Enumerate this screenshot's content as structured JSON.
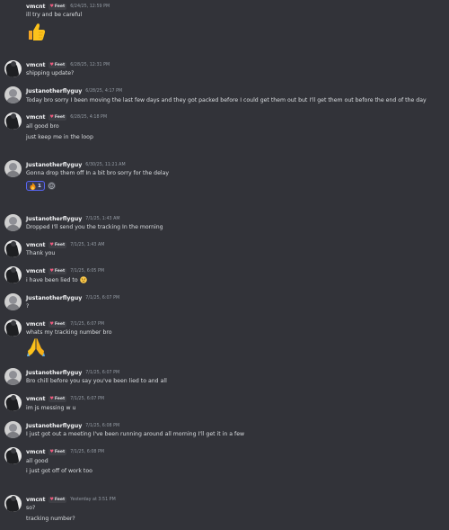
{
  "tag": {
    "name": "Feet"
  },
  "messages": [
    {
      "username": "vmcnt",
      "tag": true,
      "timestamp": "6/24/25, 12:59 PM",
      "lines": [
        "ill try and be careful"
      ]
    },
    {
      "username": "vmcnt",
      "tag": true,
      "timestamp": "6/28/25, 12:31 PM",
      "lines": [
        "shipping update?"
      ]
    },
    {
      "username": "Justanotherflyguy",
      "tag": false,
      "timestamp": "6/28/25, 4:17 PM",
      "lines": [
        "Today bro sorry I been moving the last few days and they got packed before I could get them out but I'll get them out before the end of the day"
      ]
    },
    {
      "username": "vmcnt",
      "tag": true,
      "timestamp": "6/28/25, 4:18 PM",
      "lines": [
        "all good bro",
        "just keep me in the loop"
      ]
    },
    {
      "username": "Justanotherflyguy",
      "tag": false,
      "timestamp": "6/30/25, 11:21 AM",
      "lines": [
        "Gonna drop  them off In a bit bro sorry for the delay"
      ],
      "reaction_count": "1"
    },
    {
      "username": "Justanotherflyguy",
      "tag": false,
      "timestamp": "7/1/25, 1:43 AM",
      "lines": [
        "Dropped I'll send you the tracking In the morning"
      ]
    },
    {
      "username": "vmcnt",
      "tag": true,
      "timestamp": "7/1/25, 1:43 AM",
      "lines": [
        "Thank you"
      ]
    },
    {
      "username": "vmcnt",
      "tag": true,
      "timestamp": "7/1/25, 6:05 PM",
      "lines": [
        "i have been lied to"
      ]
    },
    {
      "username": "Justanotherflyguy",
      "tag": false,
      "timestamp": "7/1/25, 6:07 PM",
      "lines": [
        "?"
      ]
    },
    {
      "username": "vmcnt",
      "tag": true,
      "timestamp": "7/1/25, 6:07 PM",
      "lines": [
        "whats my tracking number bro"
      ]
    },
    {
      "username": "Justanotherflyguy",
      "tag": false,
      "timestamp": "7/1/25, 6:07 PM",
      "lines": [
        "Bro chill before you say you've been lied to and all"
      ]
    },
    {
      "username": "vmcnt",
      "tag": true,
      "timestamp": "7/1/25, 6:07 PM",
      "lines": [
        "im js messing w u"
      ]
    },
    {
      "username": "Justanotherflyguy",
      "tag": false,
      "timestamp": "7/1/25, 6:08 PM",
      "lines": [
        "I just got out a meeting I've been running around all morning I'll get it in a few"
      ]
    },
    {
      "username": "vmcnt",
      "tag": true,
      "timestamp": "7/1/25, 6:08 PM",
      "lines": [
        "all good",
        "i just got off of work too"
      ]
    },
    {
      "username": "vmcnt",
      "tag": true,
      "timestamp": "Yesterday at 3:51 PM",
      "lines": [
        "so?",
        "tracking number?"
      ]
    }
  ]
}
